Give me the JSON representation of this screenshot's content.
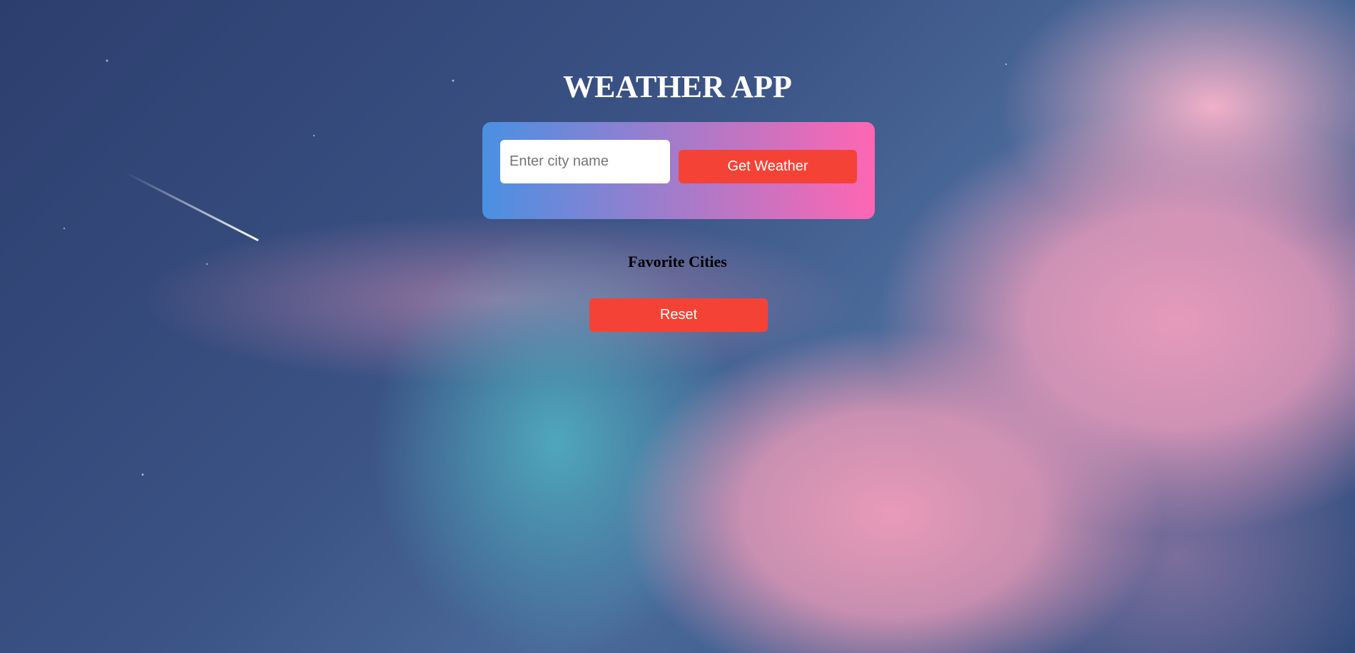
{
  "header": {
    "title": "WEATHER APP"
  },
  "search": {
    "placeholder": "Enter city name",
    "value": "",
    "button_label": "Get Weather"
  },
  "favorites": {
    "heading": "Favorite Cities",
    "reset_label": "Reset"
  },
  "colors": {
    "card_gradient_start": "#4a90e2",
    "card_gradient_end": "#ff66b2",
    "button": "#f44336"
  }
}
